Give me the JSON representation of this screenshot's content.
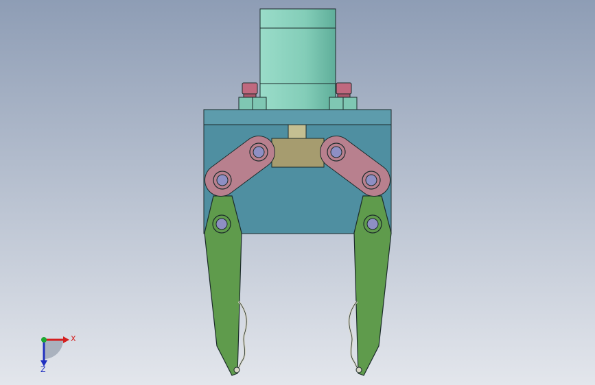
{
  "colors": {
    "background_top": "#8e9db5",
    "background_bottom": "#e3e6ec",
    "cylinder": "#83cdb8",
    "cylinder_shade": "#5fae9a",
    "body": "#4f8fa1",
    "body_top": "#5d9cac",
    "link": "#b8808e",
    "jaw": "#5f9b4c",
    "jaw_shade": "#4b823b",
    "bolt_head": "#c0697f",
    "rod": "#c4bf92",
    "crossbar": "#a69c6f",
    "pin": "#8e8fc4",
    "spring": "#d8d6c6",
    "outline": "#1b2a2a",
    "axis_x": "#d42020",
    "axis_y": "#1ea832",
    "axis_z": "#2030c0"
  },
  "icons": {
    "triad": "coordinate-triad-icon"
  },
  "triad": {
    "x_label": "X",
    "z_label": "Z"
  }
}
